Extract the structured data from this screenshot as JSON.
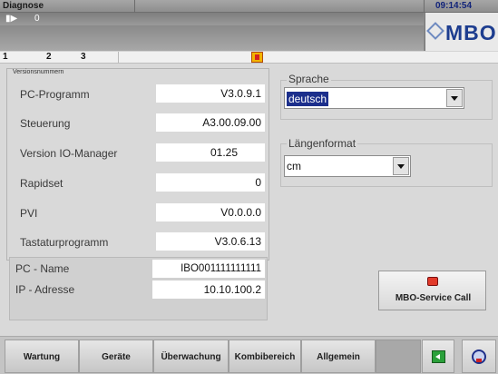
{
  "header": {
    "title": "Diagnose",
    "clock": "09:14:54",
    "progress_value": "0",
    "logo": "MBO"
  },
  "tabs": [
    "1",
    "2",
    "3"
  ],
  "versions": {
    "caption": "Versionsnummern",
    "rows": [
      {
        "label": "PC-Programm",
        "value": "V3.0.9.1"
      },
      {
        "label": "Steuerung",
        "value": "A3.00.09.00"
      },
      {
        "label": "Version IO-Manager",
        "value": "01.25"
      },
      {
        "label": "Rapidset",
        "value": "0"
      },
      {
        "label": "PVI",
        "value": "V0.0.0.0"
      },
      {
        "label": "Tastaturprogramm",
        "value": "V3.0.6.13"
      }
    ]
  },
  "network": {
    "pc_name_label": "PC - Name",
    "pc_name_value": "IBO001111111111",
    "ip_label": "IP - Adresse",
    "ip_value": "10.10.100.2"
  },
  "settings": {
    "language_label": "Sprache",
    "language_value": "deutsch",
    "length_label": "Längenformat",
    "length_value": "cm"
  },
  "service_button": {
    "label": "MBO-Service Call"
  },
  "bottom_nav": {
    "buttons": [
      "Wartung",
      "Geräte",
      "Überwachung",
      "Kombibereich",
      "Allgemein"
    ]
  },
  "colors": {
    "brand": "#1d3d8f",
    "selection": "#1c2f8c",
    "exit_icon": "#2aa03a"
  },
  "icons": {
    "progress": "play-arrow-icon",
    "warning": "warning-icon",
    "service": "phone-icon",
    "exit": "exit-icon",
    "help": "help-icon"
  }
}
